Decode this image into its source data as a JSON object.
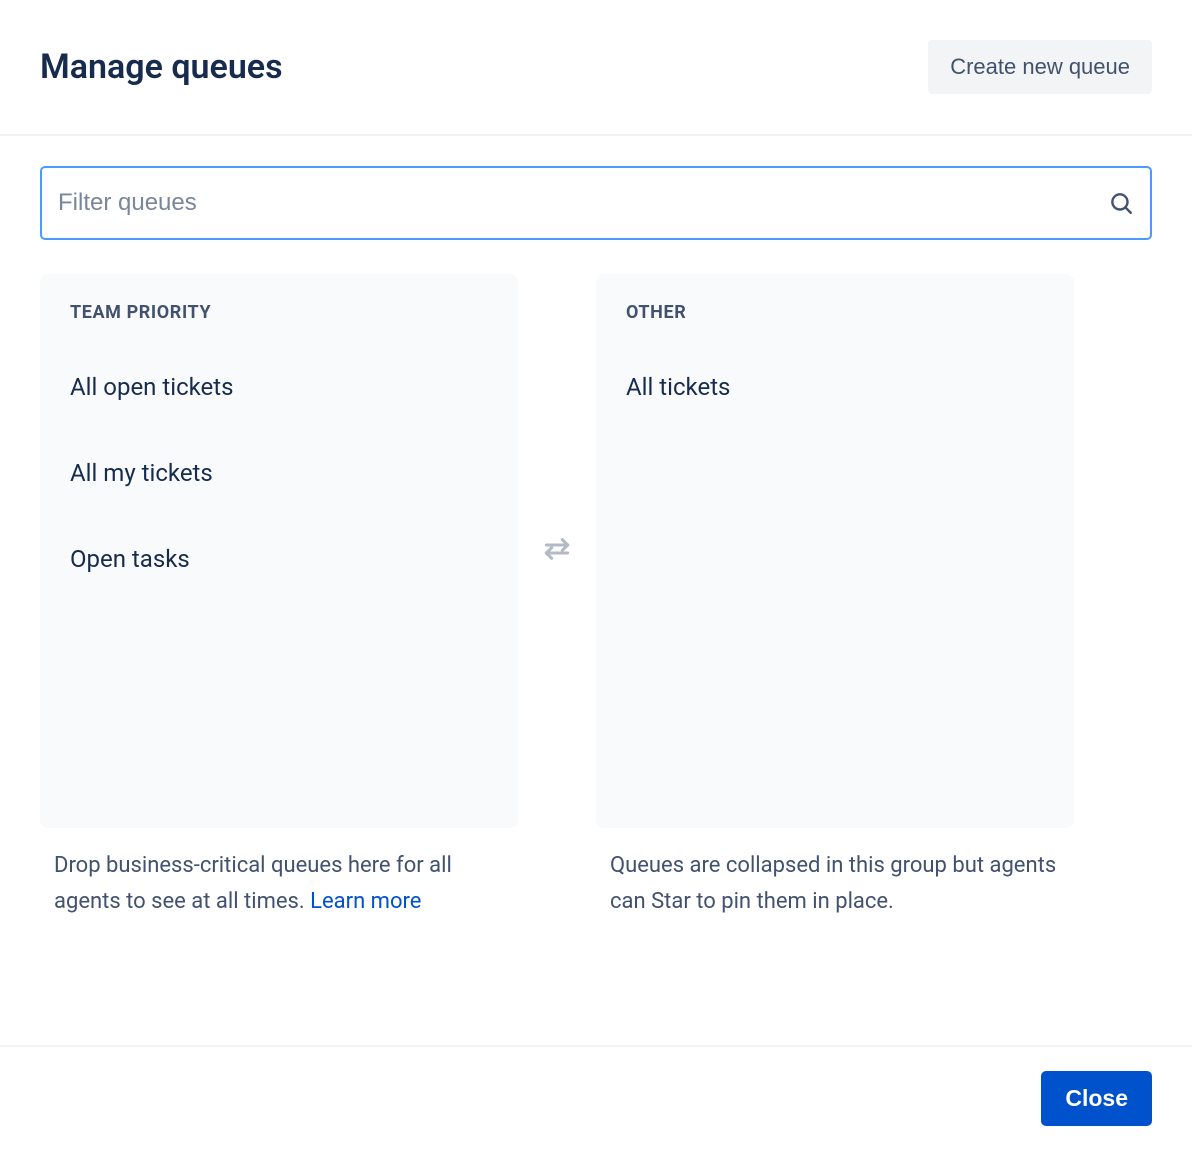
{
  "header": {
    "title": "Manage queues",
    "create_label": "Create new queue"
  },
  "search": {
    "placeholder": "Filter queues"
  },
  "columns": {
    "left": {
      "title": "TEAM PRIORITY",
      "items": [
        "All open tickets",
        "All my tickets",
        "Open tasks"
      ],
      "helper_text": "Drop business-critical queues here for all agents to see at all times. ",
      "learn_more": "Learn more"
    },
    "right": {
      "title": "OTHER",
      "items": [
        "All tickets"
      ],
      "helper_text": "Queues are collapsed in this group but agents can Star to pin them in place."
    }
  },
  "footer": {
    "close_label": "Close"
  }
}
